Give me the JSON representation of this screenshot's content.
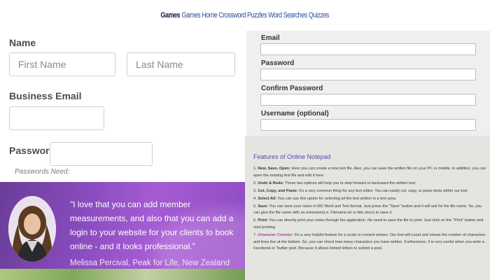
{
  "nav": {
    "brand": "Games",
    "links": [
      "Games",
      "Home",
      "Crossword Puzzles",
      "Word Searches",
      "Quizzes"
    ]
  },
  "signup": {
    "name_label": "Name",
    "first_placeholder": "First Name",
    "last_placeholder": "Last Name",
    "email_label": "Business Email",
    "password_label": "Password",
    "passwords_need": "Passwords Need:"
  },
  "testimonial": {
    "quote": "\"I love that you can add member measurements, and also that you can add a login to your website for your clients to book online - and it looks professional.\"",
    "author": "Melissa Percival, Peak for Life, New Zealand"
  },
  "account": {
    "email_label": "Email",
    "password_label": "Password",
    "confirm_label": "Confirm Password",
    "username_label": "Username (optional)"
  },
  "notepad": {
    "title": "Features of Online Notepad",
    "items": [
      {
        "term": "New, Save, Open:",
        "text": "Here you can create a new text file. Also, you can save the written file on your PC or mobile. In addition, you can open the existing text file and edit it here."
      },
      {
        "term": "Undo & Redo:",
        "text": "These two options will help you to step forward or backward the written text."
      },
      {
        "term": "Cut, Copy, and Paste:",
        "text": "It's a very common thing for any text editor. You can easily cut, copy, or paste texts within our tool."
      },
      {
        "term": "Select All:",
        "text": "You can use this option for selecting all the text written in a text area."
      },
      {
        "term": "Save:",
        "text": "You can save your notes in MS Word and Text format. Just press the \"Save\" button and it will ask for the file name. So, you can give the file name with an extension(i.e. Filename.txt or Abc.docx) to save it."
      },
      {
        "term": "Print:",
        "text": "You can directly print your notes through the application. No need to save the file to print. Just click on the \"Print\" button and start printing."
      },
      {
        "term": "Character Counter:",
        "text": "It's a very helpful feature for a script or content writers. Our tool will count and shows the number of characters and lines live at the bottom. So, you can check how many characters you have written. Furthermore, it is very useful when you write a Facebook or Twitter post. Because it allows limited letters to submit a post."
      }
    ]
  }
}
